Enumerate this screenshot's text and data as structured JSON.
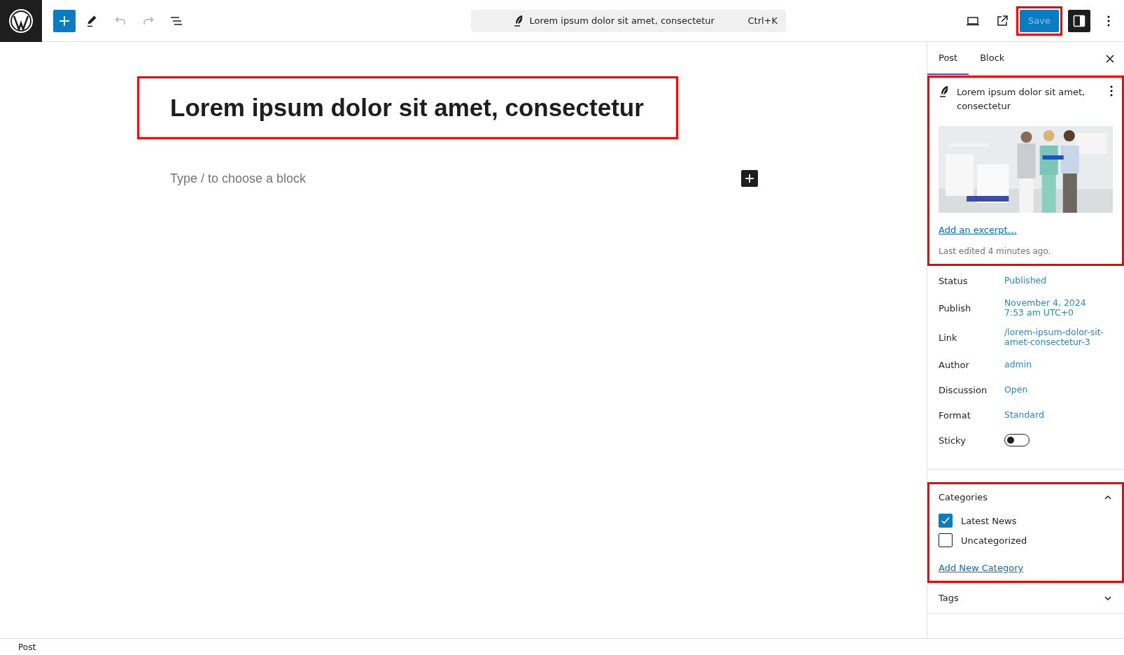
{
  "toolbar": {
    "tools": [
      {
        "kind": "inserter",
        "disabled": false
      },
      {
        "kind": "tools",
        "disabled": false
      },
      {
        "kind": "undo",
        "disabled": true
      },
      {
        "kind": "redo",
        "disabled": true
      },
      {
        "kind": "list",
        "disabled": false
      }
    ],
    "command_bar": {
      "title": "Lorem ipsum dolor sit amet, consectetur",
      "shortcut": "Ctrl+K"
    },
    "save": {
      "label": "Save",
      "disabled": true,
      "highlighted": true
    },
    "settings_pressed": true
  },
  "editor": {
    "title": "Lorem ipsum dolor sit amet, consectetur",
    "title_highlighted": true,
    "placeholder": "Type / to choose a block"
  },
  "sidebar": {
    "tabs": [
      {
        "label": "Post",
        "selected": true
      },
      {
        "label": "Block",
        "selected": false
      }
    ],
    "summary": {
      "title": "Lorem ipsum dolor sit amet, consectetur",
      "highlighted": true,
      "excerpt_link": "Add an excerpt…",
      "last_edited": "Last edited 4 minutes ago."
    },
    "fields": [
      {
        "label": "Status",
        "lines": [
          "Published"
        ]
      },
      {
        "label": "Publish",
        "lines": [
          "November 4, 2024",
          "7:53 am UTC+0"
        ]
      },
      {
        "label": "Link",
        "lines": [
          "/lorem-ipsum-dolor-sit-",
          "amet-consectetur-3"
        ]
      },
      {
        "label": "Author",
        "lines": [
          "admin"
        ]
      },
      {
        "label": "Discussion",
        "lines": [
          "Open"
        ]
      },
      {
        "label": "Format",
        "lines": [
          "Standard"
        ]
      }
    ],
    "sticky": {
      "label": "Sticky",
      "on": false
    },
    "categories": {
      "title": "Categories",
      "expanded": true,
      "highlighted": true,
      "items": [
        {
          "label": "Latest News",
          "checked": true
        },
        {
          "label": "Uncategorized",
          "checked": false
        }
      ],
      "add_link": "Add New Category"
    },
    "tags": {
      "title": "Tags",
      "expanded": false
    }
  },
  "status_bar": {
    "breadcrumb": "Post"
  }
}
